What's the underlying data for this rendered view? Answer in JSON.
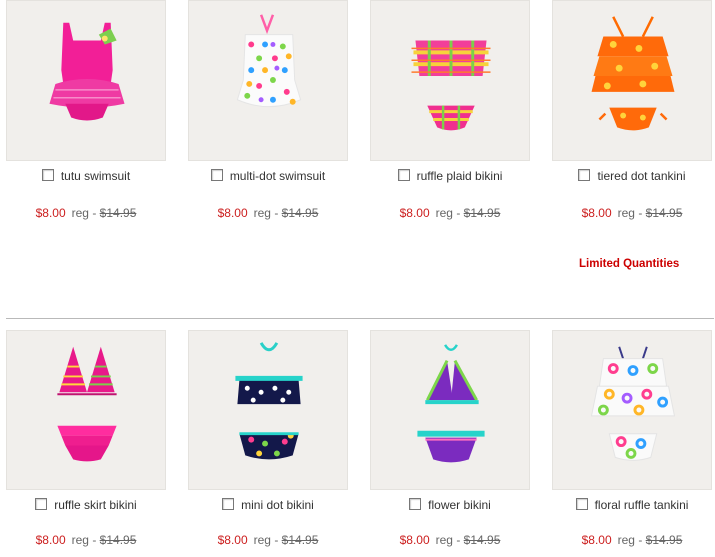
{
  "products_row1": [
    {
      "name": "tutu swimsuit",
      "sale_price": "$8.00",
      "reg_label": "reg -",
      "reg_price": "$14.95",
      "image_icon": "pink-tutu-swimsuit"
    },
    {
      "name": "multi-dot swimsuit",
      "sale_price": "$8.00",
      "reg_label": "reg -",
      "reg_price": "$14.95",
      "image_icon": "white-multi-dot-swimsuit"
    },
    {
      "name": "ruffle plaid bikini",
      "sale_price": "$8.00",
      "reg_label": "reg -",
      "reg_price": "$14.95",
      "image_icon": "plaid-ruffle-bikini"
    },
    {
      "name": "tiered dot tankini",
      "sale_price": "$8.00",
      "reg_label": "reg -",
      "reg_price": "$14.95",
      "image_icon": "orange-dot-tankini"
    }
  ],
  "limited_note": "Limited Quantities",
  "products_row2": [
    {
      "name": "ruffle skirt bikini",
      "sale_price": "$8.00",
      "reg_label": "reg -",
      "reg_price": "$14.95",
      "image_icon": "pink-ruffle-bikini"
    },
    {
      "name": "mini dot bikini",
      "sale_price": "$8.00",
      "reg_label": "reg -",
      "reg_price": "$14.95",
      "image_icon": "navy-dot-bikini"
    },
    {
      "name": "flower bikini",
      "sale_price": "$8.00",
      "reg_label": "reg -",
      "reg_price": "$14.95",
      "image_icon": "purple-teal-bikini"
    },
    {
      "name": "floral ruffle tankini",
      "sale_price": "$8.00",
      "reg_label": "reg -",
      "reg_price": "$14.95",
      "image_icon": "floral-ring-tankini"
    }
  ],
  "colors": {
    "sale_price": "#cc1f1f",
    "limited": "#cc0000",
    "image_bg": "#f1efec"
  }
}
